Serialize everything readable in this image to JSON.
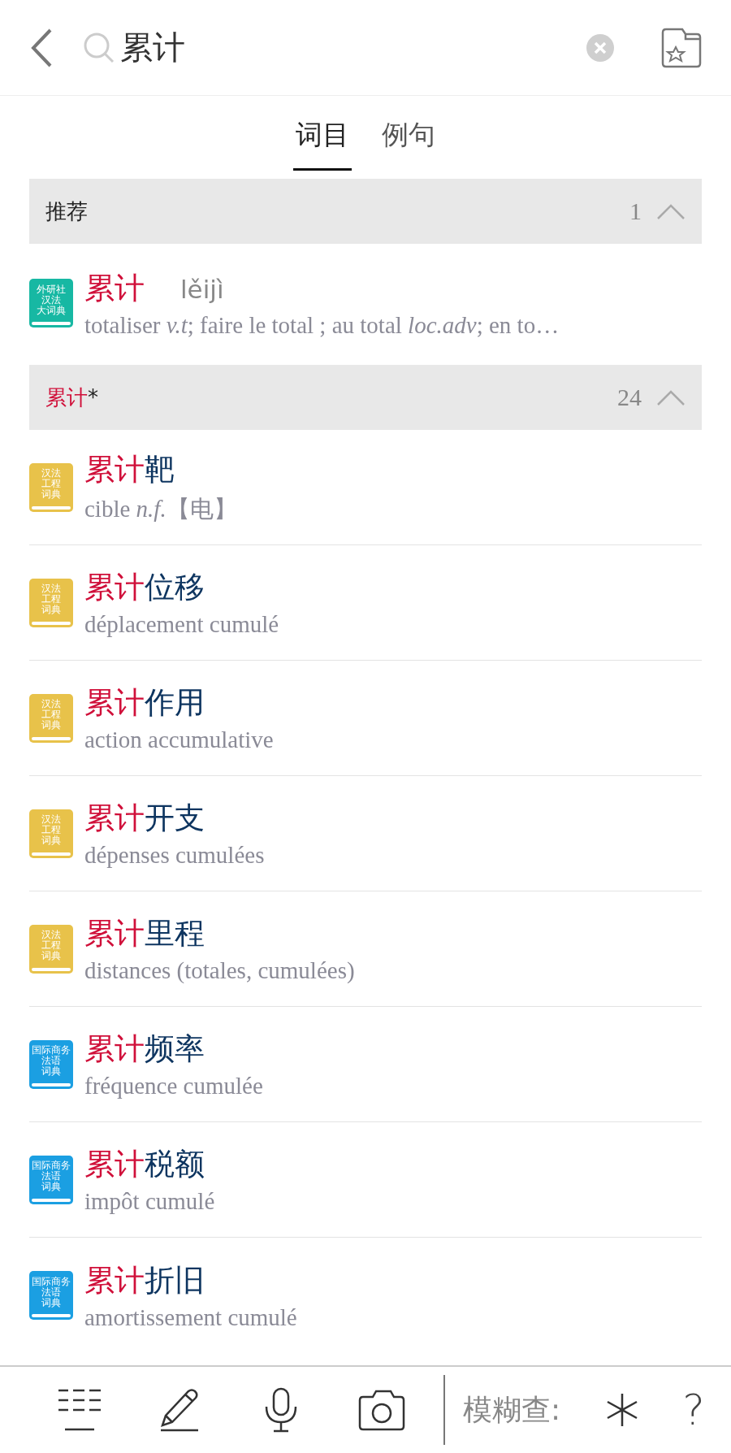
{
  "search": {
    "query": "累计"
  },
  "tabs": [
    {
      "label": "词目",
      "selected": true
    },
    {
      "label": "例句",
      "selected": false
    }
  ],
  "sections": [
    {
      "label": "推荐",
      "count": "1",
      "expanded": true,
      "entries": [
        {
          "book": {
            "color": "#17b8a3",
            "lines": [
              "外研社",
              "汉法",
              "大词典"
            ]
          },
          "match": "累计",
          "pinyin": "lěijì",
          "definition": "totaliser *v.t*; faire le total ; au total *loc.adv*; en to…"
        }
      ]
    },
    {
      "match": "累计",
      "label": "*",
      "count": "24",
      "expanded": true,
      "entries": [
        {
          "book": {
            "color": "#e8c24a",
            "lines": [
              "汉法",
              "工程",
              "词典"
            ]
          },
          "match": "累计",
          "rest": "靶",
          "definition": "cible *n.f.*【电】"
        },
        {
          "book": {
            "color": "#e8c24a",
            "lines": [
              "汉法",
              "工程",
              "词典"
            ]
          },
          "match": "累计",
          "rest": "位移",
          "definition": "déplacement cumulé"
        },
        {
          "book": {
            "color": "#e8c24a",
            "lines": [
              "汉法",
              "工程",
              "词典"
            ]
          },
          "match": "累计",
          "rest": "作用",
          "definition": "action accumulative"
        },
        {
          "book": {
            "color": "#e8c24a",
            "lines": [
              "汉法",
              "工程",
              "词典"
            ]
          },
          "match": "累计",
          "rest": "开支",
          "definition": "dépenses cumulées"
        },
        {
          "book": {
            "color": "#e8c24a",
            "lines": [
              "汉法",
              "工程",
              "词典"
            ]
          },
          "match": "累计",
          "rest": "里程",
          "definition": "distances (totales, cumulées)"
        },
        {
          "book": {
            "color": "#1b9fe2",
            "lines": [
              "国际商务",
              "法语",
              "词典"
            ]
          },
          "match": "累计",
          "rest": "频率",
          "definition": "fréquence cumulée"
        },
        {
          "book": {
            "color": "#1b9fe2",
            "lines": [
              "国际商务",
              "法语",
              "词典"
            ]
          },
          "match": "累计",
          "rest": "税额",
          "definition": "impôt cumulé"
        },
        {
          "book": {
            "color": "#1b9fe2",
            "lines": [
              "国际商务",
              "法语",
              "词典"
            ]
          },
          "match": "累计",
          "rest": "折旧",
          "definition": "amortissement cumulé"
        }
      ]
    }
  ],
  "toolbar": {
    "fuzzy_label": "模糊查:",
    "question": "?"
  }
}
